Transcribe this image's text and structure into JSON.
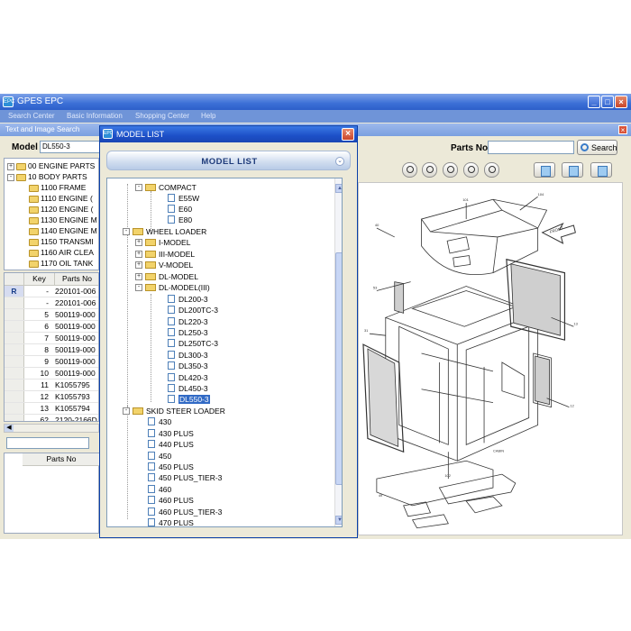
{
  "app": {
    "title": "GPES EPC",
    "icon_text": "EPC",
    "menu": [
      "Search Center",
      "Basic Information",
      "Shopping Center",
      "Help"
    ],
    "panel_title": "Text and Image Search",
    "model_label": "Model",
    "model_value": "DL550-3",
    "parts_no_label": "Parts No",
    "search_label": "Search"
  },
  "left_tree": [
    {
      "code": "00 ENGINE PARTS",
      "level": 0,
      "expander": "+"
    },
    {
      "code": "10 BODY PARTS",
      "level": 0,
      "expander": "-"
    },
    {
      "code": "1100 FRAME",
      "level": 1
    },
    {
      "code": "1110 ENGINE (",
      "level": 1
    },
    {
      "code": "1120 ENGINE (",
      "level": 1
    },
    {
      "code": "1130 ENGINE M",
      "level": 1
    },
    {
      "code": "1140 ENGINE M",
      "level": 1
    },
    {
      "code": "1150 TRANSMI",
      "level": 1
    },
    {
      "code": "1160 AIR CLEA",
      "level": 1
    },
    {
      "code": "1170 OIL TANK",
      "level": 1
    }
  ],
  "parts_grid": {
    "headers": [
      "Key",
      "Parts No"
    ],
    "rows": [
      {
        "marker": "R",
        "key": "-",
        "part": "220101-006"
      },
      {
        "marker": "",
        "key": "-",
        "part": "220101-006"
      },
      {
        "marker": "",
        "key": "5",
        "part": "500119-000"
      },
      {
        "marker": "",
        "key": "6",
        "part": "500119-000"
      },
      {
        "marker": "",
        "key": "7",
        "part": "500119-000"
      },
      {
        "marker": "",
        "key": "8",
        "part": "500119-000"
      },
      {
        "marker": "",
        "key": "9",
        "part": "500119-000"
      },
      {
        "marker": "",
        "key": "10",
        "part": "500119-000"
      },
      {
        "marker": "",
        "key": "11",
        "part": "K1055795"
      },
      {
        "marker": "",
        "key": "12",
        "part": "K1055793"
      },
      {
        "marker": "",
        "key": "13",
        "part": "K1055794"
      },
      {
        "marker": "",
        "key": "62",
        "part": "2120-2166D"
      }
    ]
  },
  "lower_grid": {
    "header": "Parts No"
  },
  "dialog": {
    "title": "MODEL LIST",
    "banner": "MODEL LIST",
    "tree": [
      {
        "label": "COMPACT",
        "type": "folder",
        "level": 1,
        "expander": "-"
      },
      {
        "label": "E55W",
        "type": "doc",
        "level": 2
      },
      {
        "label": "E60",
        "type": "doc",
        "level": 2
      },
      {
        "label": "E80",
        "type": "doc",
        "level": 2
      },
      {
        "label": "WHEEL LOADER",
        "type": "folder",
        "level": 0,
        "expander": "-"
      },
      {
        "label": "I-MODEL",
        "type": "folder",
        "level": 1,
        "expander": "+"
      },
      {
        "label": "III-MODEL",
        "type": "folder",
        "level": 1,
        "expander": "+"
      },
      {
        "label": "V-MODEL",
        "type": "folder",
        "level": 1,
        "expander": "+"
      },
      {
        "label": "DL-MODEL",
        "type": "folder",
        "level": 1,
        "expander": "+"
      },
      {
        "label": "DL-MODEL(III)",
        "type": "folder",
        "level": 1,
        "expander": "-"
      },
      {
        "label": "DL200-3",
        "type": "doc",
        "level": 2
      },
      {
        "label": "DL200TC-3",
        "type": "doc",
        "level": 2
      },
      {
        "label": "DL220-3",
        "type": "doc",
        "level": 2
      },
      {
        "label": "DL250-3",
        "type": "doc",
        "level": 2
      },
      {
        "label": "DL250TC-3",
        "type": "doc",
        "level": 2
      },
      {
        "label": "DL300-3",
        "type": "doc",
        "level": 2
      },
      {
        "label": "DL350-3",
        "type": "doc",
        "level": 2
      },
      {
        "label": "DL420-3",
        "type": "doc",
        "level": 2
      },
      {
        "label": "DL450-3",
        "type": "doc",
        "level": 2
      },
      {
        "label": "DL550-3",
        "type": "doc",
        "level": 2,
        "selected": true
      },
      {
        "label": "SKID STEER LOADER",
        "type": "folder",
        "level": 0,
        "expander": "-"
      },
      {
        "label": "430",
        "type": "doc",
        "level": 1
      },
      {
        "label": "430 PLUS",
        "type": "doc",
        "level": 1
      },
      {
        "label": "440 PLUS",
        "type": "doc",
        "level": 1
      },
      {
        "label": "450",
        "type": "doc",
        "level": 1
      },
      {
        "label": "450 PLUS",
        "type": "doc",
        "level": 1
      },
      {
        "label": "450 PLUS_TIER-3",
        "type": "doc",
        "level": 1
      },
      {
        "label": "460",
        "type": "doc",
        "level": 1
      },
      {
        "label": "460 PLUS",
        "type": "doc",
        "level": 1
      },
      {
        "label": "460 PLUS_TIER-3",
        "type": "doc",
        "level": 1
      },
      {
        "label": "470 PLUS",
        "type": "doc",
        "level": 1
      }
    ]
  },
  "drawing": {
    "front_label": "FRONT",
    "cabin_label": "CABIN"
  },
  "icons": {
    "app": "app-logo-icon",
    "minimize": "minimize-icon",
    "maximize": "maximize-icon",
    "close": "close-icon",
    "search": "magnifier-icon",
    "tools": [
      "refresh-icon",
      "zoom-window-icon",
      "zoom-in-icon",
      "zoom-out-icon",
      "zoom-fit-icon"
    ],
    "docs": [
      "print-icon",
      "image-export-icon",
      "image-save-icon"
    ]
  }
}
